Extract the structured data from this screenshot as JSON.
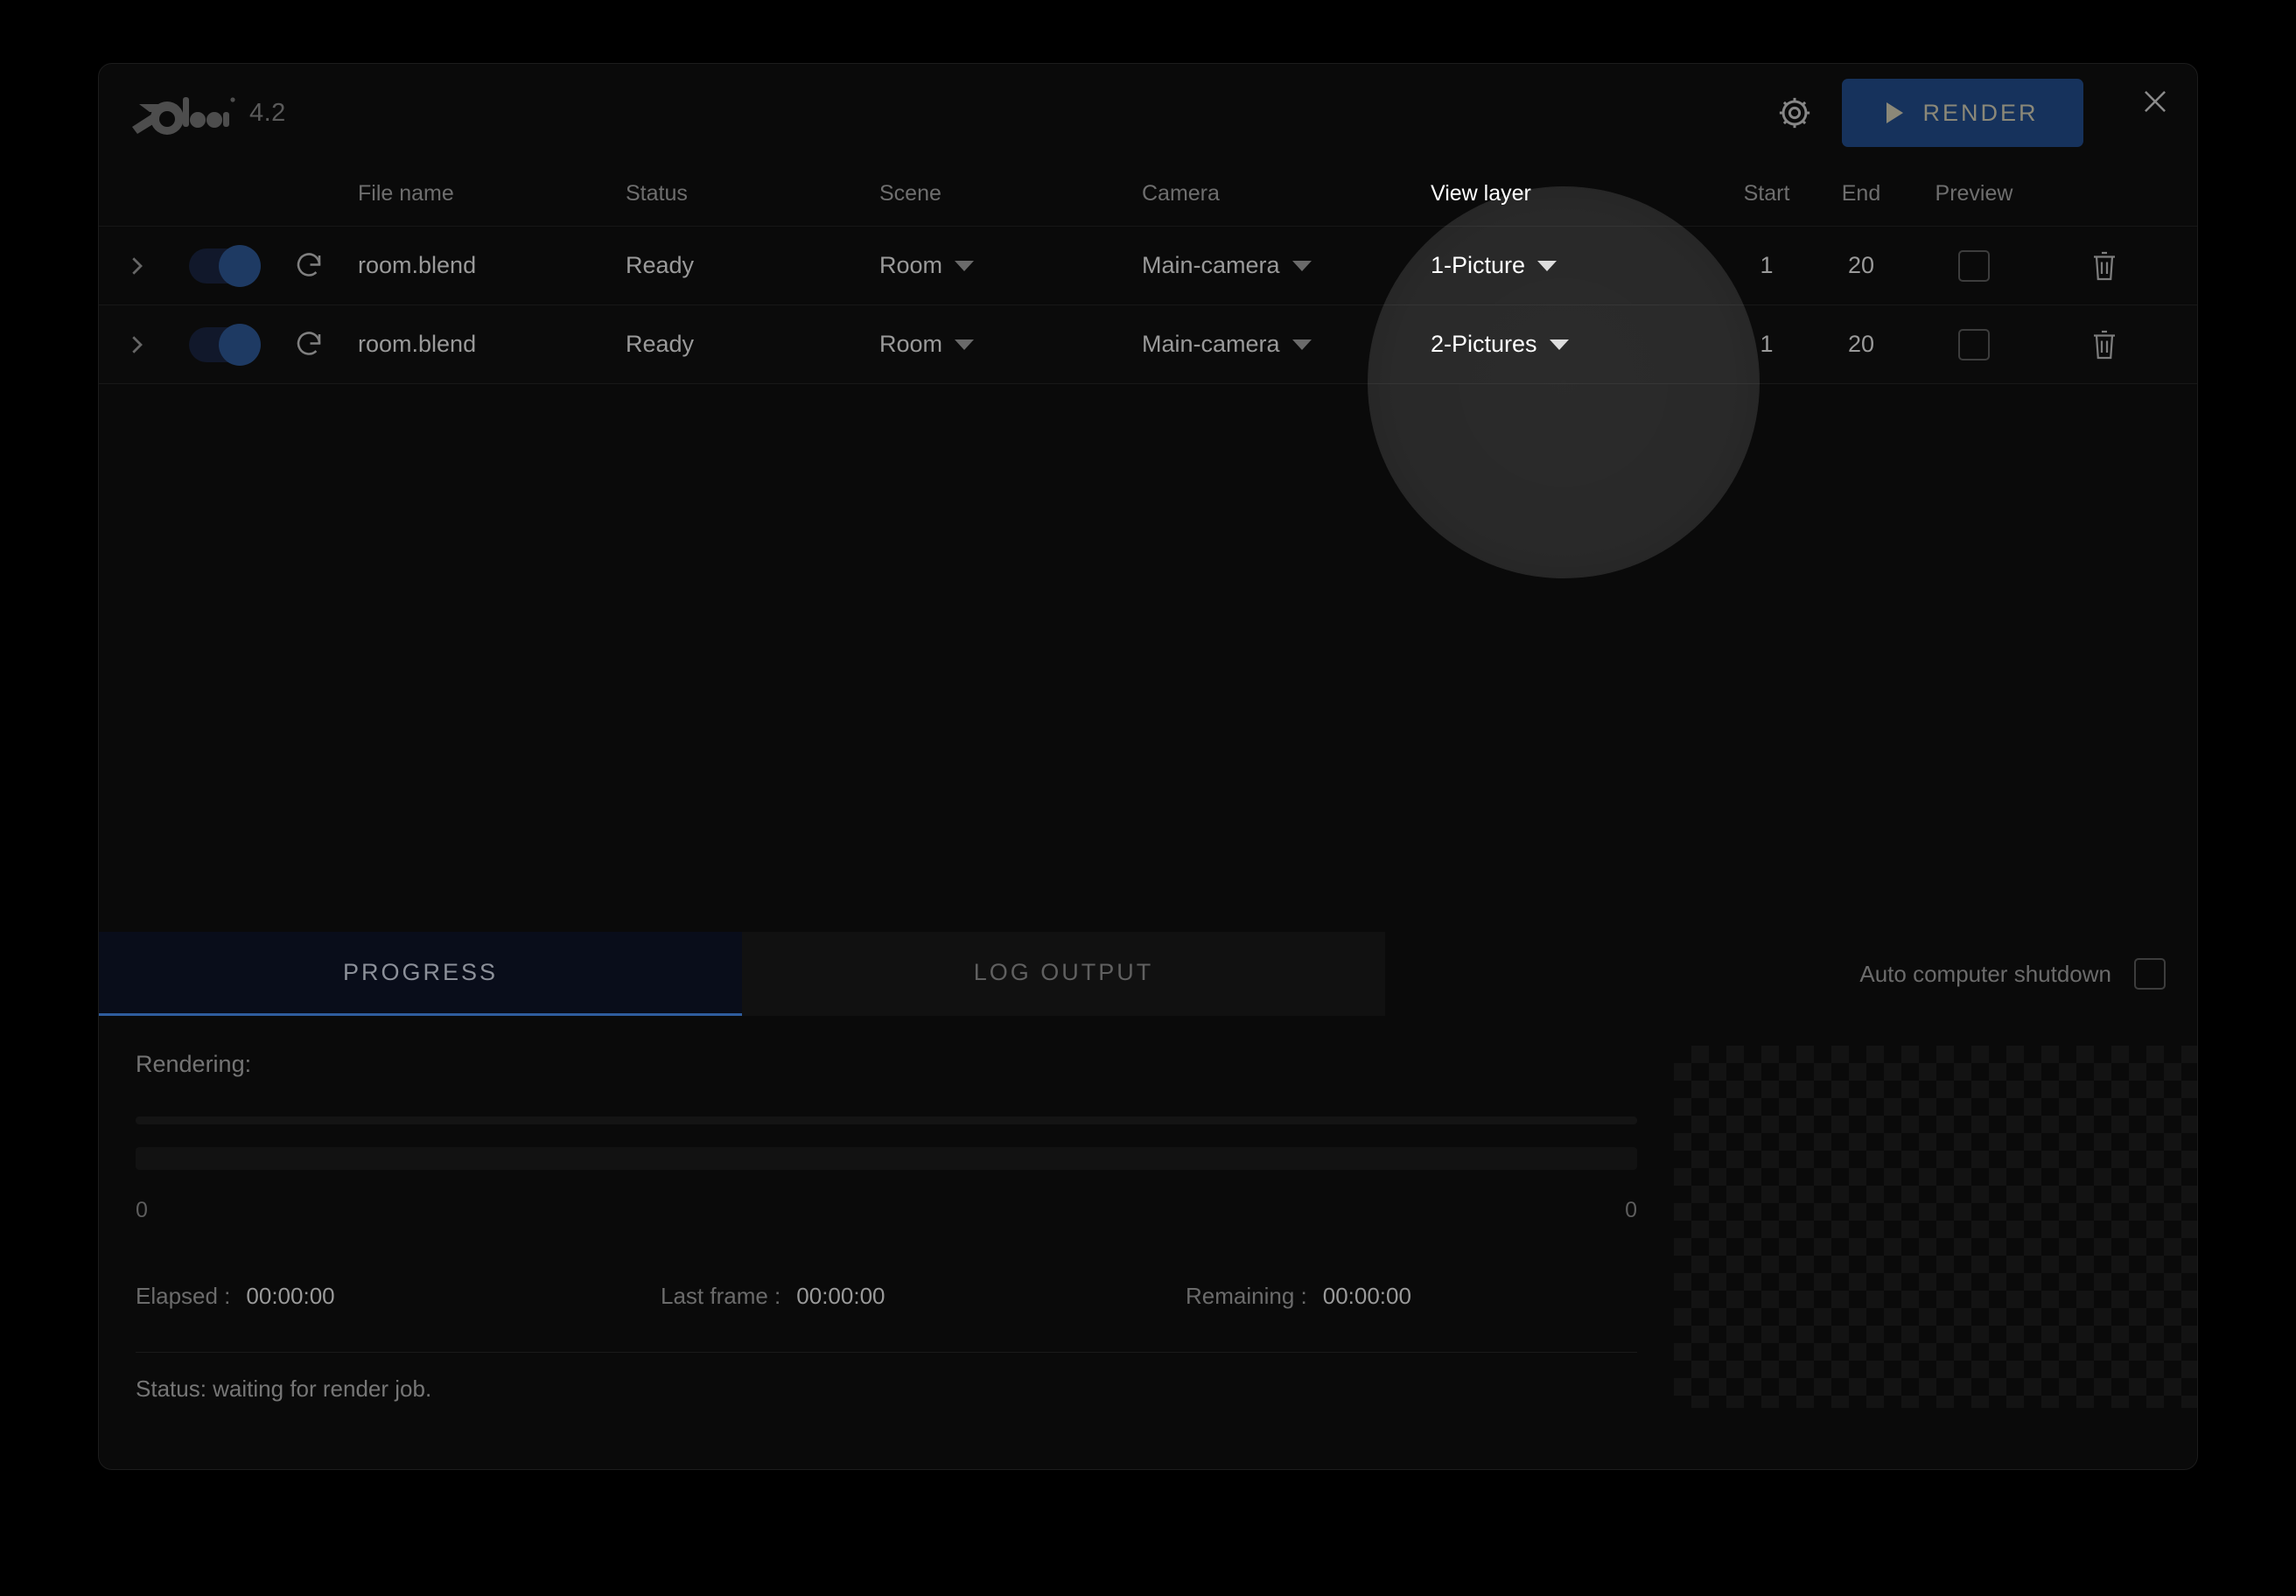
{
  "app": {
    "brand_name": "blender",
    "version": "4.2",
    "logo_icon": "blender-logo-icon",
    "settings_icon": "gear-icon",
    "close_icon": "close-icon",
    "render_button": "RENDER",
    "render_icon": "play-triangle-icon"
  },
  "table": {
    "headers": {
      "file_name": "File name",
      "status": "Status",
      "scene": "Scene",
      "camera": "Camera",
      "view_layer": "View layer",
      "start": "Start",
      "end": "End",
      "preview": "Preview"
    },
    "rows": [
      {
        "expand_icon": "chevron-right-icon",
        "enabled": true,
        "refresh_icon": "refresh-icon",
        "file_name": "room.blend",
        "status": "Ready",
        "scene": "Room",
        "camera": "Main-camera",
        "view_layer": "1-Picture",
        "start": "1",
        "end": "20",
        "preview_checked": false,
        "delete_icon": "trash-icon",
        "handle_icon": "drag-handle-icon"
      },
      {
        "expand_icon": "chevron-right-icon",
        "enabled": true,
        "refresh_icon": "refresh-icon",
        "file_name": "room.blend",
        "status": "Ready",
        "scene": "Room",
        "camera": "Main-camera",
        "view_layer": "2-Pictures",
        "start": "1",
        "end": "20",
        "preview_checked": false,
        "delete_icon": "trash-icon",
        "handle_icon": "drag-handle-icon"
      }
    ]
  },
  "tabs": {
    "progress": "PROGRESS",
    "log_output": "LOG OUTPUT",
    "active": "PROGRESS"
  },
  "shutdown": {
    "label": "Auto computer shutdown",
    "checked": false
  },
  "progress": {
    "rendering_label": "Rendering:",
    "bar_min": "0",
    "bar_max": "0",
    "elapsed_label": "Elapsed :",
    "elapsed_value": "00:00:00",
    "last_frame_label": "Last frame :",
    "last_frame_value": "00:00:00",
    "remaining_label": "Remaining :",
    "remaining_value": "00:00:00",
    "status": "Status: waiting for render job."
  },
  "colors": {
    "accent_blue": "#16325c",
    "tab_underline": "#2f5d9e",
    "toggle_on": "#1e3a63",
    "window_bg": "#0a0a0a"
  }
}
